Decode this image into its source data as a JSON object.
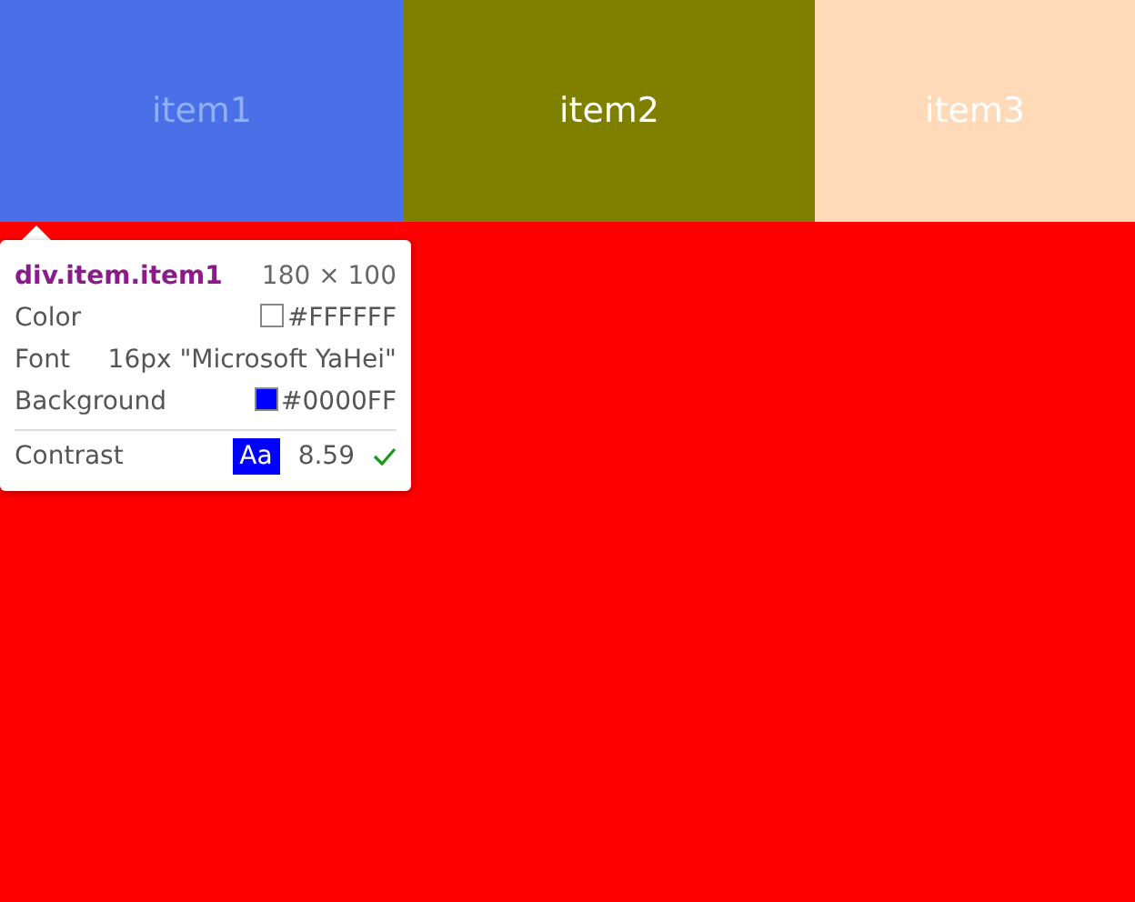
{
  "items": [
    {
      "label": "item1",
      "color": "#4a6fe6",
      "highlighted": true
    },
    {
      "label": "item2",
      "color": "#7f7f00",
      "highlighted": false
    },
    {
      "label": "item3",
      "color": "#ffdab9",
      "highlighted": false
    }
  ],
  "tooltip": {
    "selector": "div.item.item1",
    "size": "180 × 100",
    "rows": [
      {
        "kind": "color",
        "label": "Color",
        "value": "#FFFFFF",
        "color": "#ffffff"
      },
      {
        "kind": "text",
        "label": "Font",
        "value": "16px \"Microsoft YaHei\""
      },
      {
        "kind": "color",
        "label": "Background",
        "value": "#0000FF",
        "color": "#0000ff"
      }
    ],
    "contrast": {
      "label": "Contrast",
      "sample": "Aa",
      "ratio": "8.59",
      "passed": true
    }
  }
}
